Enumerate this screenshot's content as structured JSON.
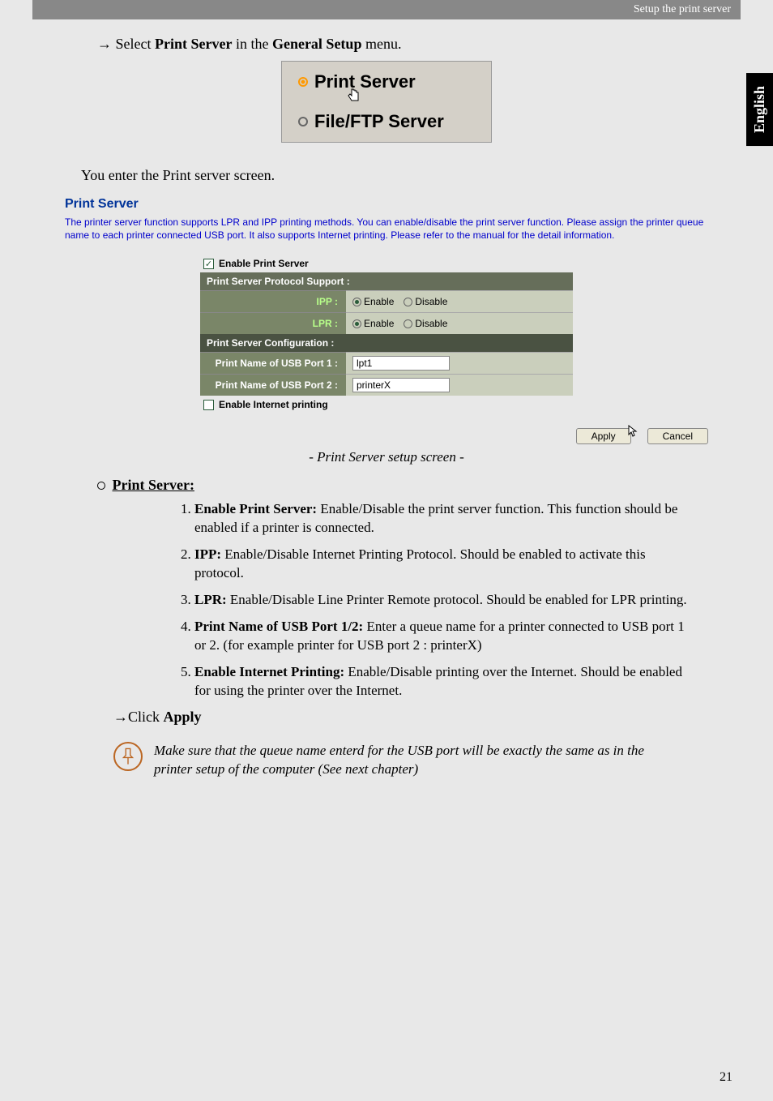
{
  "header": {
    "breadcrumb": "Setup the print server"
  },
  "sideTab": {
    "label": "English"
  },
  "instruction1": {
    "prefix": "Select ",
    "bold1": "Print Server",
    "mid": " in the ",
    "bold2": "General Setup",
    "suffix": " menu."
  },
  "menuImage": {
    "opt1": "Print Server",
    "opt2": "File/FTP Server"
  },
  "bodyText1": "You enter the Print server screen.",
  "psScreen": {
    "title": "Print Server",
    "desc": "The printer server function supports LPR and IPP printing methods. You can enable/disable the print server function. Please assign the printer queue name to each printer connected USB port. It also supports Internet printing. Please refer to the manual for the detail information.",
    "chkEnable": "Enable Print Server",
    "sectProtocol": "Print Server Protocol Support :",
    "rowIPP": "IPP :",
    "rowLPR": "LPR :",
    "optEnable": "Enable",
    "optDisable": "Disable",
    "sectConfig": "Print Server Configuration :",
    "rowPort1": "Print Name of USB Port 1 :",
    "valPort1": "lpt1",
    "rowPort2": "Print Name of USB Port 2 :",
    "valPort2": "printerX",
    "chkInternet": "Enable Internet printing",
    "btnApply": "Apply",
    "btnCancel": "Cancel"
  },
  "caption": "- Print Server setup screen -",
  "sectionLabel": "Print Server:",
  "items": [
    {
      "b": "Enable Print Server:",
      "t": " Enable/Disable the print server function. This function should be enabled if a printer is connected."
    },
    {
      "b": "IPP:",
      "t": " Enable/Disable Internet Printing Protocol. Should be enabled to activate this protocol."
    },
    {
      "b": "LPR:",
      "t": " Enable/Disable Line Printer Remote protocol. Should be enabled for LPR printing."
    },
    {
      "b": "Print Name of USB Port 1/2:",
      "t": " Enter a queue name for a printer connected to USB port 1 or 2. (for example printer for USB port 2 : printerX)"
    },
    {
      "b": "Enable Internet Printing:",
      "t": " Enable/Disable printing over the Internet. Should be enabled for using the printer over the Internet."
    }
  ],
  "clickApply": {
    "pre": "Click ",
    "bold": "Apply"
  },
  "note": "Make sure that the queue name enterd for the USB port will be exactly the same as in the printer setup of the computer (See next chapter)",
  "pageNum": "21"
}
